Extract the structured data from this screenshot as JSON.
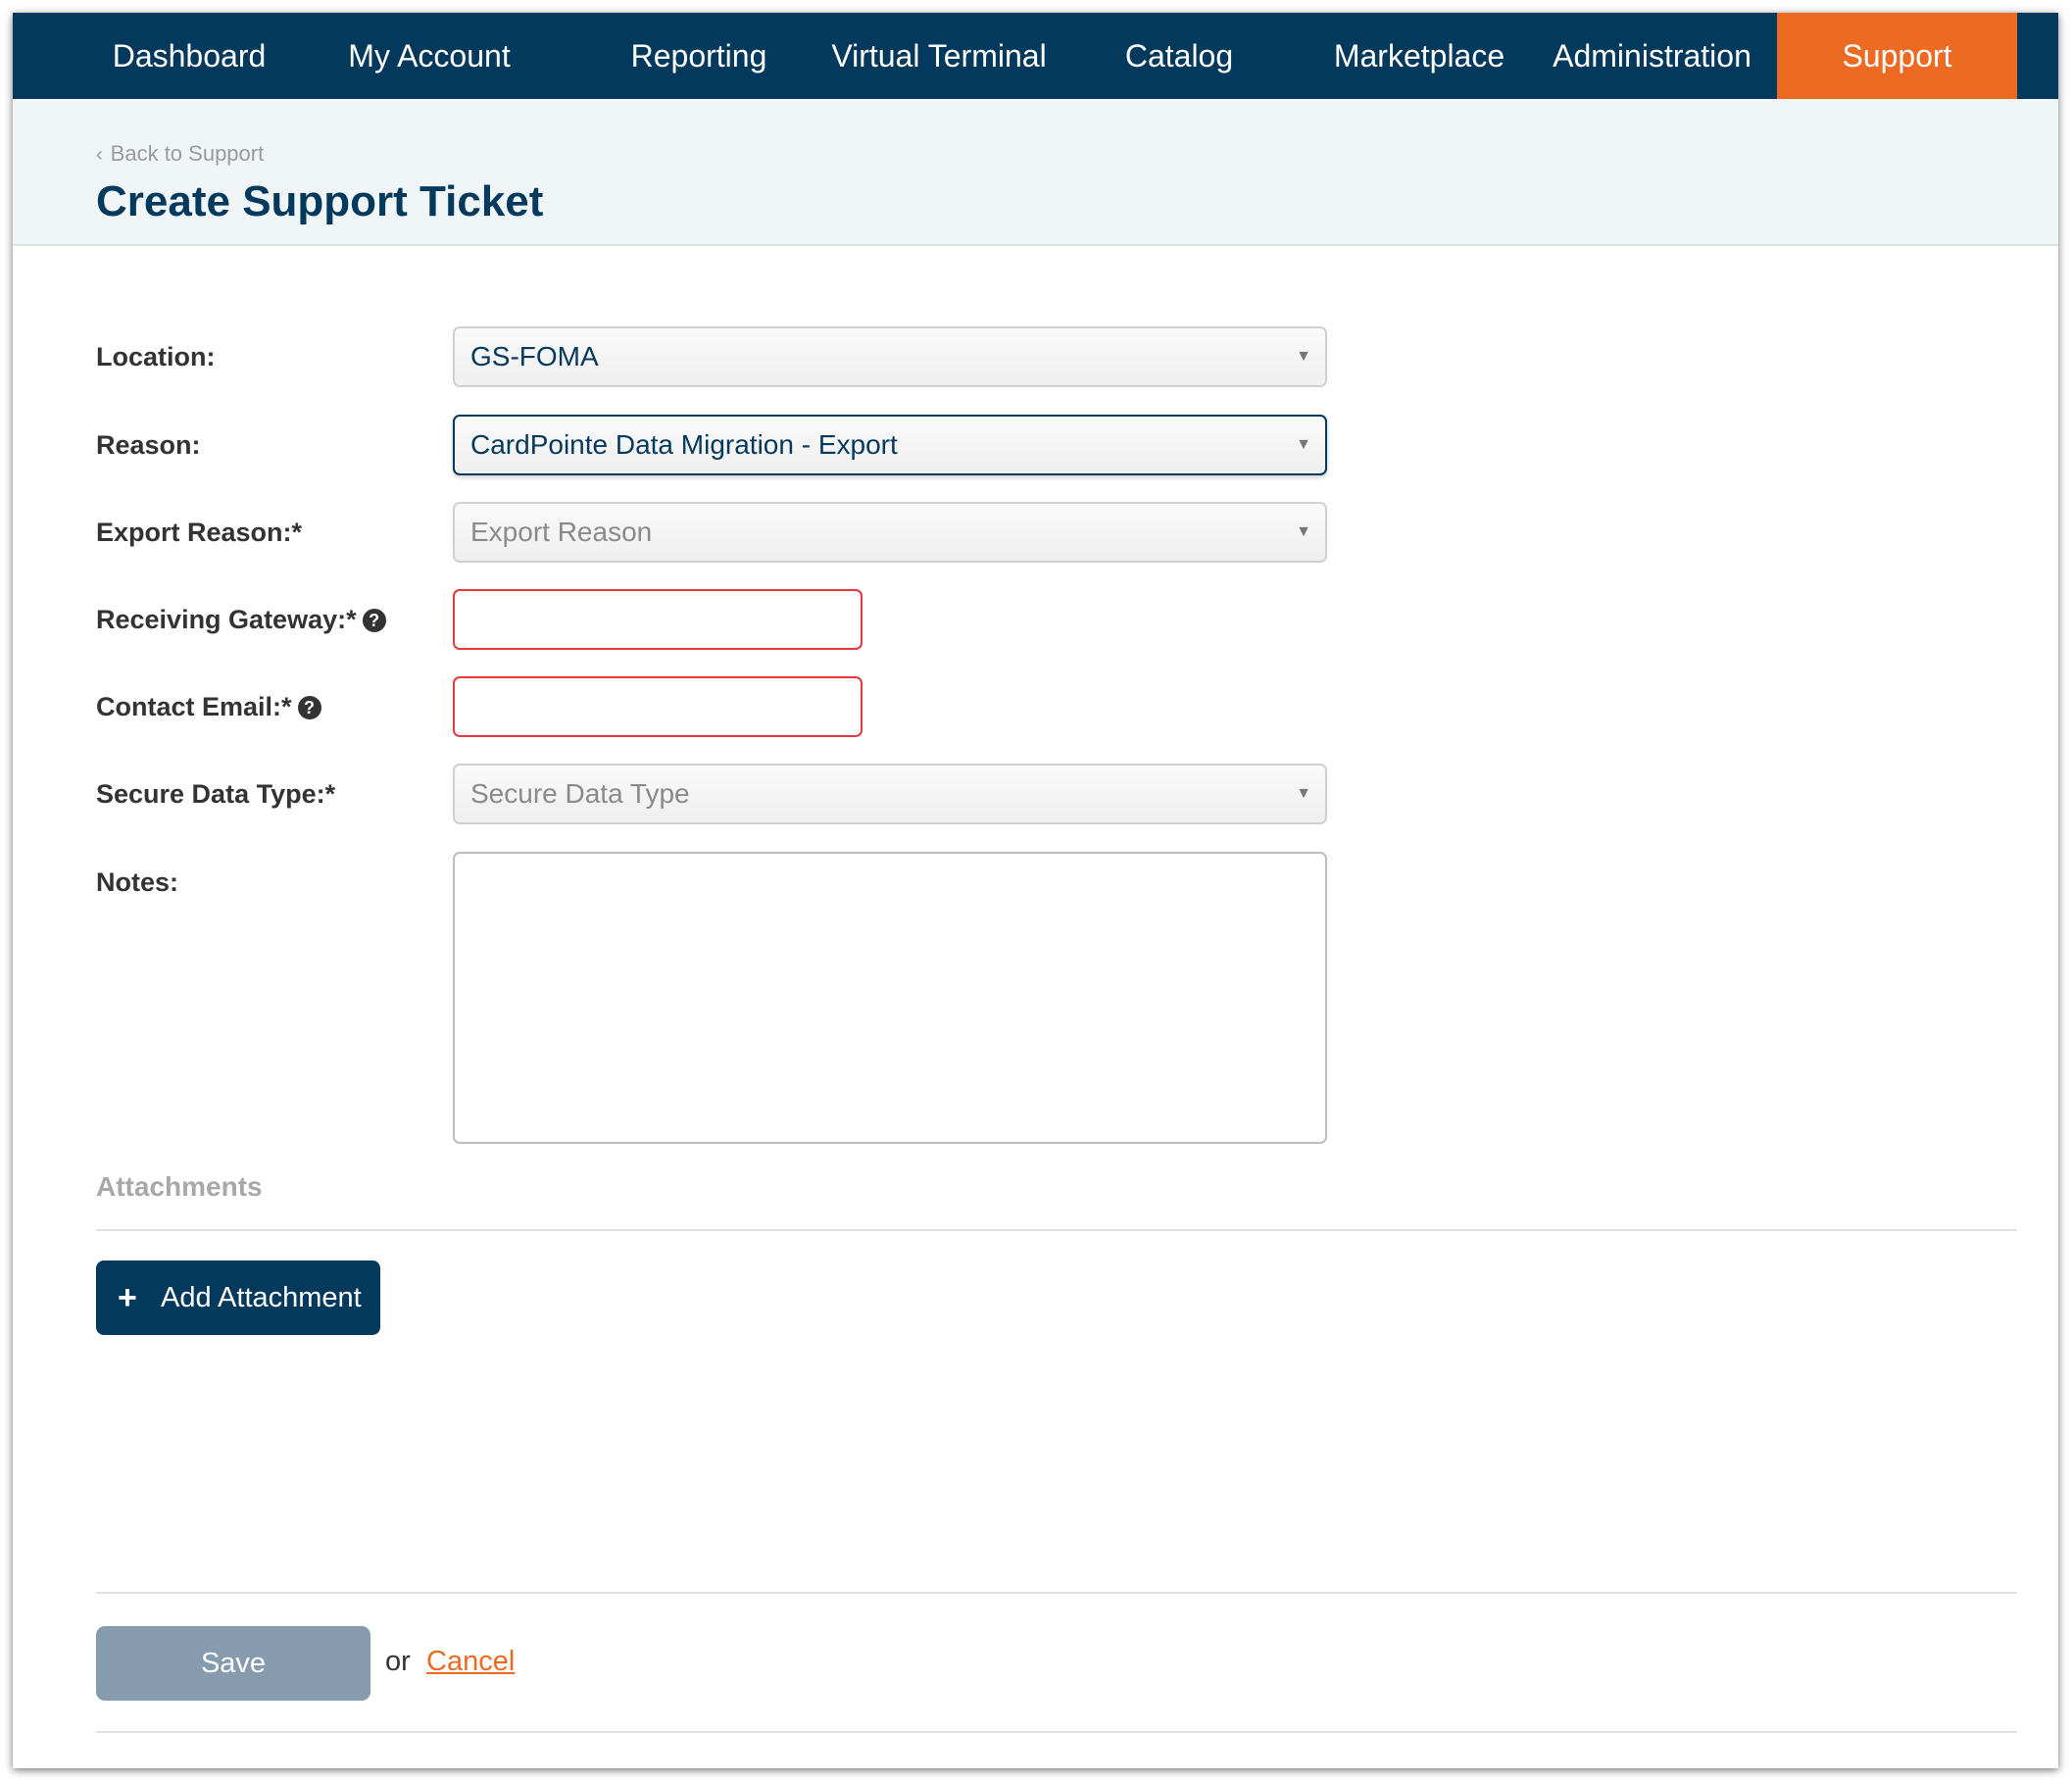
{
  "nav": {
    "items": [
      {
        "label": "Dashboard"
      },
      {
        "label": "My Account"
      },
      {
        "label": "Reporting"
      },
      {
        "label": "Virtual Terminal"
      },
      {
        "label": "Catalog"
      },
      {
        "label": "Marketplace"
      },
      {
        "label": "Administration"
      },
      {
        "label": "Support",
        "active": true
      }
    ]
  },
  "header": {
    "back_link": "Back to Support",
    "title": "Create Support Ticket"
  },
  "form": {
    "location": {
      "label": "Location:",
      "value": "GS-FOMA"
    },
    "reason": {
      "label": "Reason:",
      "value": "CardPointe Data Migration - Export"
    },
    "export_reason": {
      "label": "Export Reason:*",
      "placeholder": "Export Reason"
    },
    "receiving_gateway": {
      "label": "Receiving Gateway:*",
      "value": ""
    },
    "contact_email": {
      "label": "Contact Email:*",
      "value": ""
    },
    "secure_data_type": {
      "label": "Secure Data Type:*",
      "placeholder": "Secure Data Type"
    },
    "notes": {
      "label": "Notes:",
      "value": ""
    }
  },
  "attachments": {
    "heading": "Attachments",
    "add_button": "Add Attachment"
  },
  "actions": {
    "save": "Save",
    "or": "or",
    "cancel": "Cancel"
  },
  "colors": {
    "nav_bg": "#03395c",
    "accent": "#ec6a22",
    "error_border": "#e8383d",
    "save_disabled": "#869cae"
  }
}
